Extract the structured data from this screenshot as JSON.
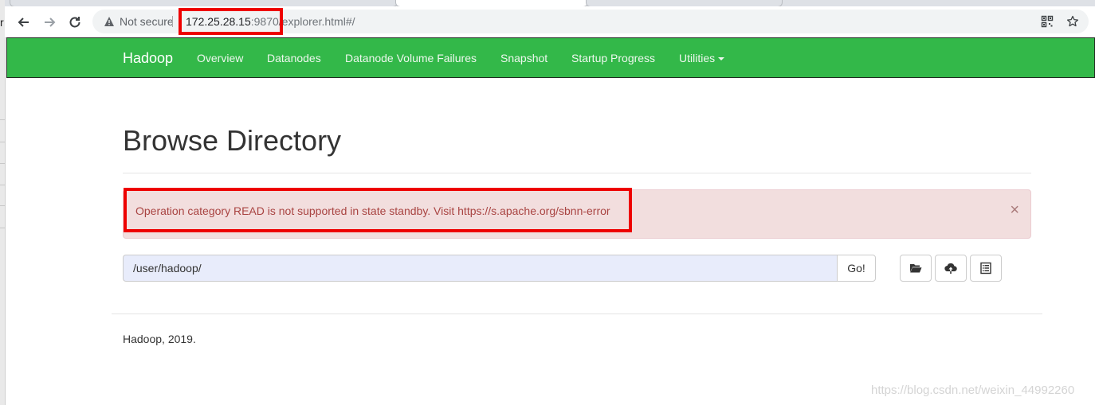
{
  "browser": {
    "security_label": "Not secure",
    "url_host": "172.25.28.15",
    "url_rest": ":9870/explorer.html#/",
    "icons": {
      "back": "arrow-left-icon",
      "forward": "arrow-right-icon",
      "reload": "reload-icon",
      "security": "warning-triangle-icon",
      "qr": "qr-code-icon",
      "bookmark": "star-icon"
    }
  },
  "navbar": {
    "brand": "Hadoop",
    "items": [
      {
        "label": "Overview"
      },
      {
        "label": "Datanodes"
      },
      {
        "label": "Datanode Volume Failures"
      },
      {
        "label": "Snapshot"
      },
      {
        "label": "Startup Progress"
      },
      {
        "label": "Utilities"
      }
    ],
    "color": "#33b849"
  },
  "page": {
    "title": "Browse Directory"
  },
  "alert": {
    "message": "Operation category READ is not supported in state standby. Visit https://s.apache.org/sbnn-error",
    "close_label": "×",
    "color": "#f2dede"
  },
  "path_bar": {
    "value": "/user/hadoop/",
    "go_label": "Go!"
  },
  "actions": [
    {
      "icon": "folder-open-icon"
    },
    {
      "icon": "cloud-upload-icon"
    },
    {
      "icon": "list-icon"
    }
  ],
  "footer": {
    "text": "Hadoop, 2019."
  },
  "watermark": "https://blog.csdn.net/weixin_44992260",
  "annotations": {
    "highlight_color": "#ee0000"
  }
}
